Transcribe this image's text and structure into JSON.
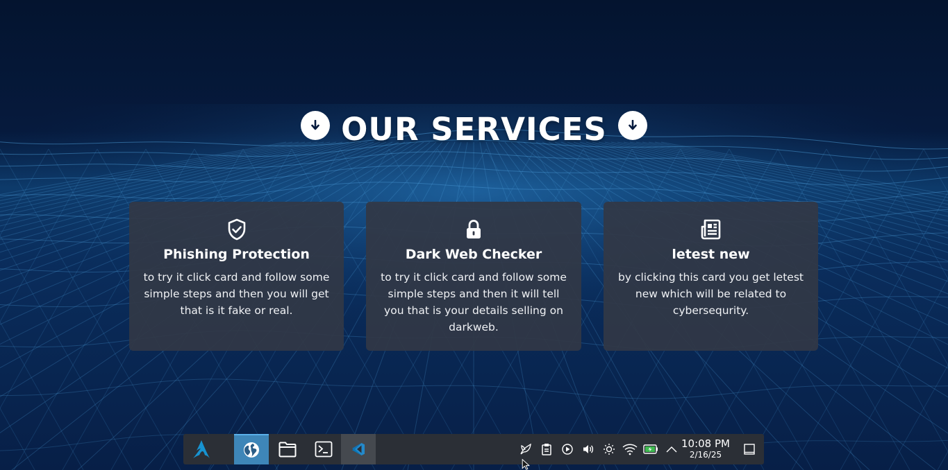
{
  "section": {
    "title": "OUR SERVICES",
    "left_icon": "arrow-down-icon",
    "right_icon": "arrow-down-icon"
  },
  "cards": [
    {
      "icon": "shield-check-icon",
      "title": "Phishing Protection",
      "description": "to try it click card and follow some simple steps and then you will get that is it fake or real."
    },
    {
      "icon": "lock-icon",
      "title": "Dark Web Checker",
      "description": "to try it click card and follow some simple steps and then it will tell you that is your details selling on darkweb."
    },
    {
      "icon": "newspaper-icon",
      "title": "letest new",
      "description": "by clicking this card you get letest new which will be related to cybersequrity."
    }
  ],
  "taskbar": {
    "launcher_icon": "arch-linux-icon",
    "apps": [
      {
        "name": "browser",
        "icon": "globe-icon",
        "state": "active"
      },
      {
        "name": "files",
        "icon": "folder-icon",
        "state": "normal"
      },
      {
        "name": "terminal",
        "icon": "terminal-icon",
        "state": "normal"
      },
      {
        "name": "vscode",
        "icon": "vscode-icon",
        "state": "open"
      }
    ],
    "tray_icons": [
      "leaf-icon",
      "clipboard-icon",
      "media-play-icon",
      "volume-icon",
      "brightness-icon",
      "wifi-icon",
      "battery-icon",
      "chevron-up-icon"
    ],
    "clock": {
      "time": "10:08 PM",
      "date": "2/16/25"
    },
    "show_desktop_icon": "show-desktop-icon"
  },
  "colors": {
    "background": "#05183a",
    "card_bg": "#323846",
    "taskbar_bg": "#2b2f36",
    "active_app": "#3e86b8",
    "text": "#ffffff"
  }
}
